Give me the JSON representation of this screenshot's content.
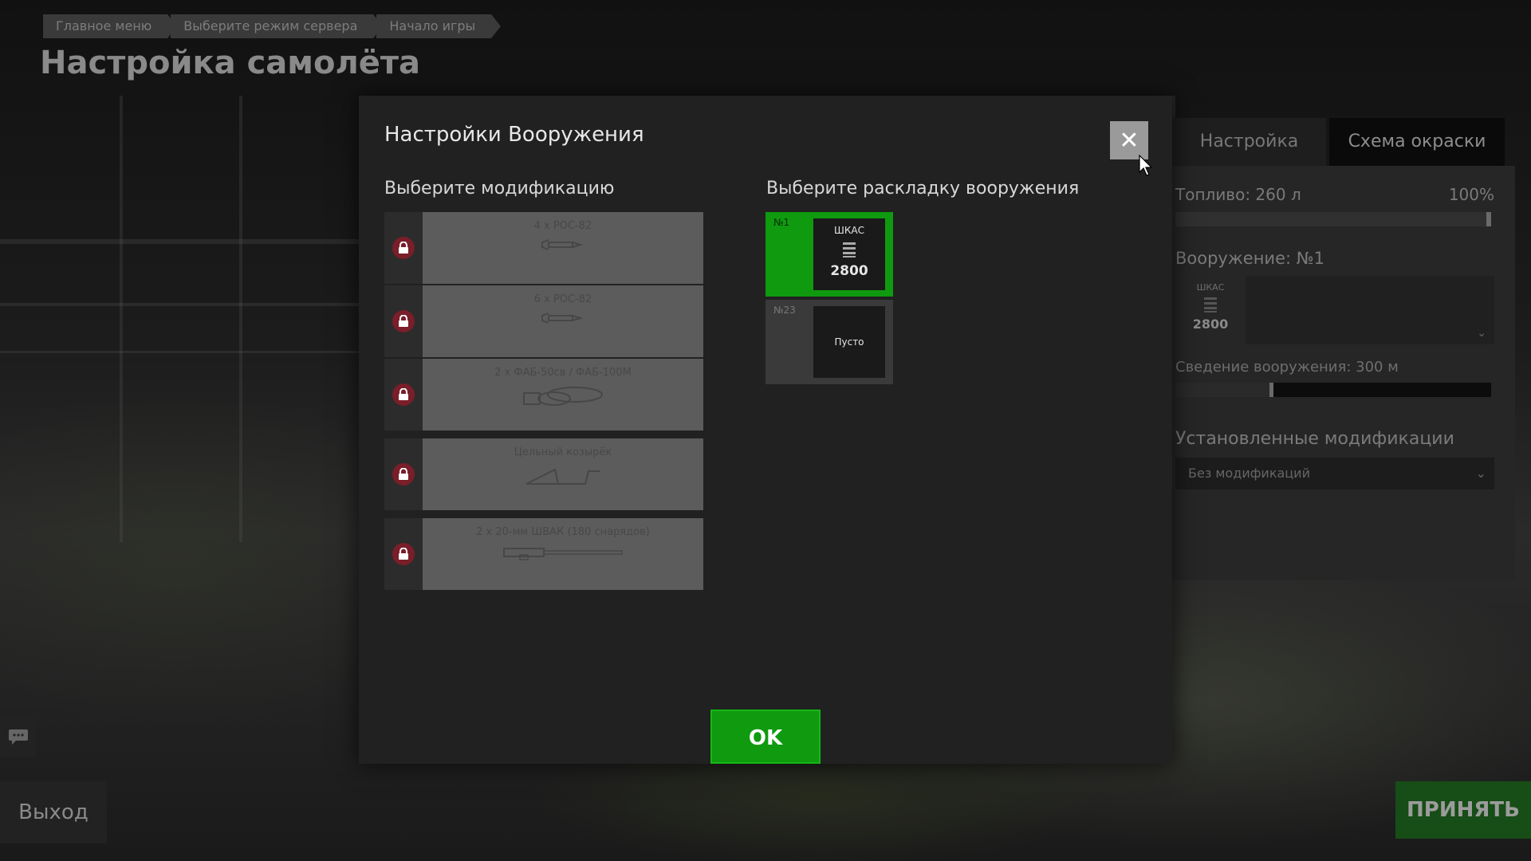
{
  "breadcrumb": [
    "Главное меню",
    "Выберите режим сервера",
    "Начало игры"
  ],
  "page_title": "Настройка самолёта",
  "exit_label": "Выход",
  "accept_label": "ПРИНЯТЬ",
  "right_panel": {
    "tabs": [
      "Настройка",
      "Схема окраски"
    ],
    "fuel_label": "Топливо: 260 л",
    "fuel_percent": "100%",
    "weapon_label": "Вооружение: №1",
    "weapon_name": "ШКАС",
    "weapon_ammo": "2800",
    "convergence_label": "Сведение вооружения: 300 м",
    "mods_label": "Установленные модификации",
    "mods_value": "Без модификаций"
  },
  "modal": {
    "title": "Настройки Вооружения",
    "mods_heading": "Выберите модификацию",
    "loadout_heading": "Выберите раскладку вооружения",
    "mods": [
      {
        "label": "4 х РОС-82",
        "icon": "rocket-icon"
      },
      {
        "label": "6 х РОС-82",
        "icon": "rocket-icon"
      },
      {
        "label": "2 х ФАБ-50св / ФАБ-100М",
        "icon": "bomb-icon"
      },
      {
        "label": "Цельный козырёк",
        "icon": "windscreen-icon"
      },
      {
        "label": "2 х 20-мм ШВАК (180 снарядов)",
        "icon": "cannon-icon"
      }
    ],
    "loadouts": [
      {
        "num": "№1",
        "weapon": "ШКАС",
        "ammo": "2800",
        "selected": true
      },
      {
        "num": "№23",
        "empty": "Пусто",
        "selected": false
      }
    ],
    "ok_label": "OK"
  },
  "colors": {
    "accent": "#0f9a0f",
    "lock": "#7a1e2a"
  }
}
